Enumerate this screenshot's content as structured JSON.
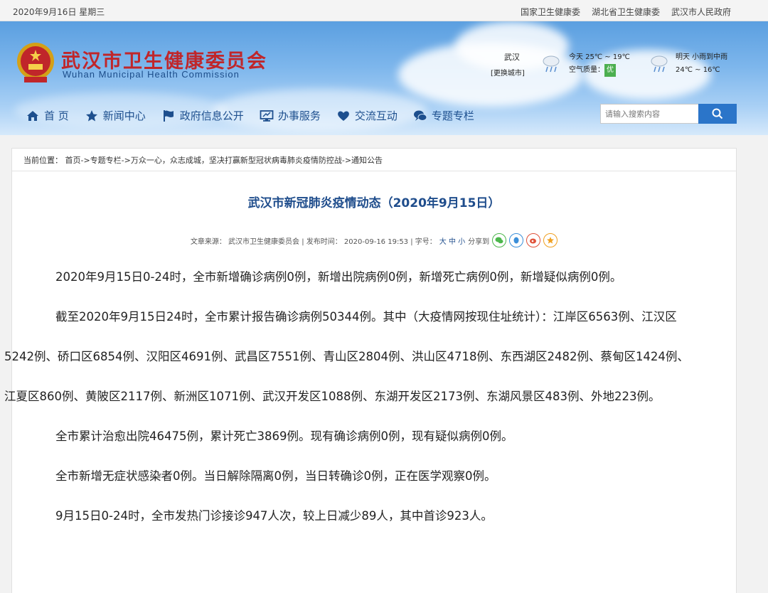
{
  "topbar": {
    "date": "2020年9月16日 星期三",
    "links": [
      "国家卫生健康委",
      "湖北省卫生健康委",
      "武汉市人民政府"
    ]
  },
  "header": {
    "site_name_cn": "武汉市卫生健康委员会",
    "site_name_en": "Wuhan Municipal Health Commission"
  },
  "weather": {
    "city": "武汉",
    "change_city": "[更换城市]",
    "today_temp": "今天 25℃ ~ 19℃",
    "air_quality_label": "空气质量：",
    "air_quality_value": "优",
    "tomorrow_desc": "明天 小雨到中雨",
    "tomorrow_temp": "24℃ ~ 16℃"
  },
  "nav": {
    "items": [
      {
        "label": "首 页",
        "icon": "home-icon"
      },
      {
        "label": "新闻中心",
        "icon": "star-icon"
      },
      {
        "label": "政府信息公开",
        "icon": "flag-icon"
      },
      {
        "label": "办事服务",
        "icon": "monitor-icon"
      },
      {
        "label": "交流互动",
        "icon": "heart-icon"
      },
      {
        "label": "专题专栏",
        "icon": "chat-icon"
      }
    ]
  },
  "search": {
    "placeholder": "请输入搜索内容",
    "icon": "search-icon"
  },
  "breadcrumb": "当前位置： 首页->专题专栏->万众一心，众志成城，坚决打赢新型冠状病毒肺炎疫情防控战->通知公告",
  "article": {
    "title": "武汉市新冠肺炎疫情动态（2020年9月15日）",
    "meta_source": "文章来源： 武汉市卫生健康委员会 | 发布时间： 2020-09-16 19:53 | 字号：",
    "font_sizes": "大 中 小",
    "share_label": "分享到",
    "paragraphs": [
      "2020年9月15日0-24时，全市新增确诊病例0例，新增出院病例0例，新增死亡病例0例，新增疑似病例0例。",
      "截至2020年9月15日24时，全市累计报告确诊病例50344例。其中（大疫情网按现住址统计）：江岸区6563例、江汉区5242例、硚口区6854例、汉阳区4691例、武昌区7551例、青山区2804例、洪山区4718例、东西湖区2482例、蔡甸区1424例、江夏区860例、黄陂区2117例、新洲区1071例、武汉开发区1088例、东湖开发区2173例、东湖风景区483例、外地223例。",
      "全市累计治愈出院46475例，累计死亡3869例。现有确诊病例0例，现有疑似病例0例。",
      "全市新增无症状感染者0例。当日解除隔离0例，当日转确诊0例，正在医学观察0例。",
      "9月15日0-24时，全市发热门诊接诊947人次，较上日减少89人，其中首诊923人。"
    ]
  },
  "colors": {
    "brand_red": "#c0262a",
    "nav_blue": "#1d4f8e",
    "search_blue": "#2b75c9"
  }
}
